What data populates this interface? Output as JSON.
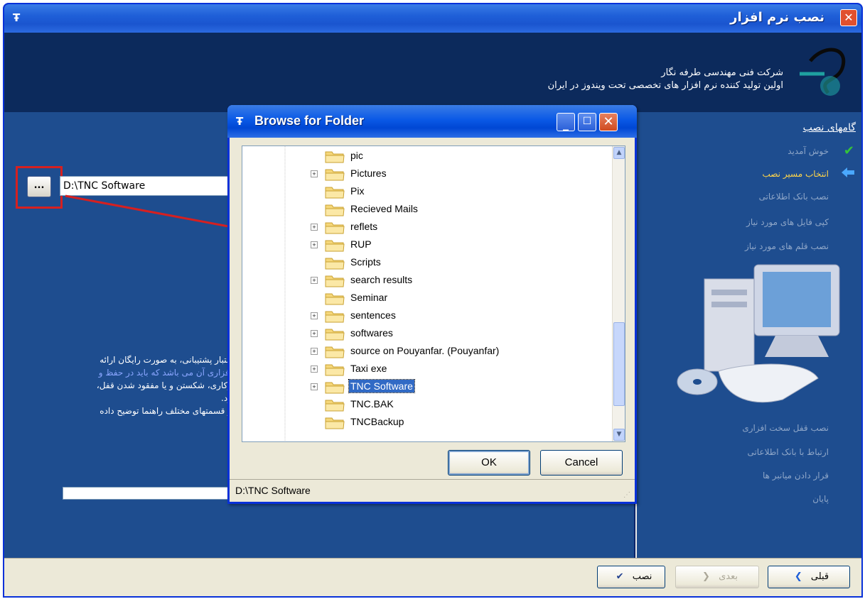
{
  "window": {
    "title": "نصب نرم افزار",
    "close_glyph": "✕",
    "icon_glyph": "Ŧ"
  },
  "header": {
    "company_line1": "شرکت فنی مهندسی طرفه نگار",
    "company_line2": "اولین تولید کننده نرم افزار های تخصصی تحت ویندوز در ایران"
  },
  "steps": {
    "title": "گامهای نصب",
    "items": [
      {
        "label": "خوش آمدید",
        "state": "done"
      },
      {
        "label": "انتخاب مسیر نصب",
        "state": "active"
      },
      {
        "label": "نصب بانک اطلاعاتی",
        "state": "pending"
      },
      {
        "label": "کپی فایل های مورد نیاز",
        "state": "pending"
      },
      {
        "label": "نصب قلم های مورد نیاز",
        "state": "pending"
      },
      {
        "label": "نصب قفل سخت افزاری",
        "state": "pending"
      },
      {
        "label": "ارتباط با بانک اطلاعاتی",
        "state": "pending"
      },
      {
        "label": "قرار دادن میانبر ها",
        "state": "pending"
      },
      {
        "label": "پایان",
        "state": "pending"
      }
    ]
  },
  "main": {
    "path_value": "D:\\TNC Software",
    "browse_label": "...",
    "description_lines": [
      "عتبار پشتیبانی، به صورت رایگان ارائه",
      "افزاری  آن می باشد  که  باید در حفظ  و",
      "رکاری، شکستن و یا مفقود شدن قفل،",
      "ود.",
      "ر قسمتهای مختلف راهنما توضیح داده"
    ]
  },
  "dialog": {
    "title": "Browse for Folder",
    "min_glyph": "_",
    "max_glyph": "☐",
    "close_glyph": "✕",
    "ok_label": "OK",
    "cancel_label": "Cancel",
    "status_path": "D:\\TNC Software",
    "tree": [
      {
        "label": "pic",
        "expandable": false,
        "selected": false
      },
      {
        "label": "Pictures",
        "expandable": true,
        "selected": false
      },
      {
        "label": "Pix",
        "expandable": false,
        "selected": false
      },
      {
        "label": "Recieved Mails",
        "expandable": false,
        "selected": false
      },
      {
        "label": "reflets",
        "expandable": true,
        "selected": false
      },
      {
        "label": "RUP",
        "expandable": true,
        "selected": false
      },
      {
        "label": "Scripts",
        "expandable": false,
        "selected": false
      },
      {
        "label": "search results",
        "expandable": true,
        "selected": false
      },
      {
        "label": "Seminar",
        "expandable": false,
        "selected": false
      },
      {
        "label": "sentences",
        "expandable": true,
        "selected": false
      },
      {
        "label": "softwares",
        "expandable": true,
        "selected": false
      },
      {
        "label": "source on Pouyanfar. (Pouyanfar)",
        "expandable": true,
        "selected": false
      },
      {
        "label": "Taxi exe",
        "expandable": true,
        "selected": false
      },
      {
        "label": "TNC Software",
        "expandable": true,
        "selected": true
      },
      {
        "label": "TNC.BAK",
        "expandable": false,
        "selected": false
      },
      {
        "label": "TNCBackup",
        "expandable": false,
        "selected": false
      }
    ]
  },
  "footer": {
    "install_label": "نصب",
    "next_label": "بعدی",
    "prev_label": "قبلی"
  },
  "colors": {
    "accent_red": "#d62020",
    "active_step": "#ffd54a",
    "selection": "#316ac5"
  }
}
